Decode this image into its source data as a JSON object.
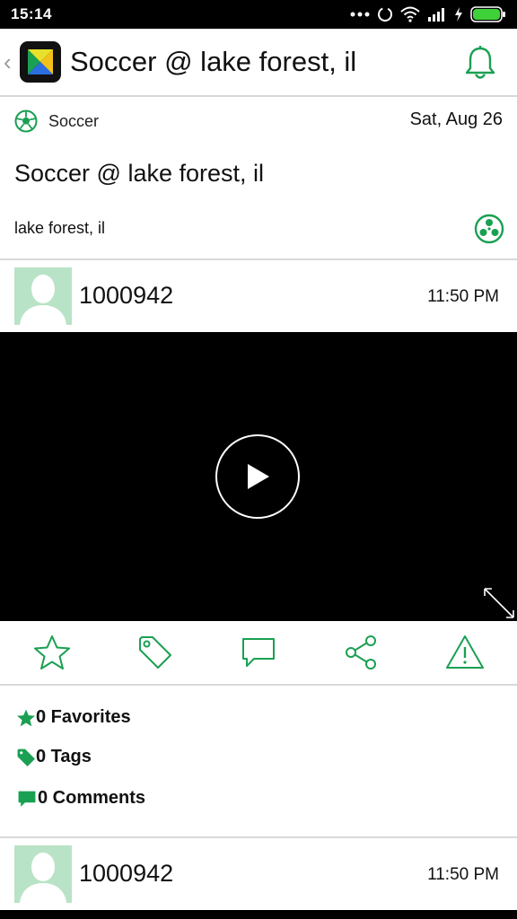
{
  "status_bar": {
    "time": "15:14"
  },
  "app_bar": {
    "title": "Soccer @ lake forest, il"
  },
  "event": {
    "sport": "Soccer",
    "date": "Sat, Aug 26",
    "title": "Soccer @ lake forest, il",
    "location": "lake forest, il"
  },
  "posts": [
    {
      "username": "1000942",
      "time": "11:50 PM"
    },
    {
      "username": "1000942",
      "time": "11:50 PM"
    }
  ],
  "actions": [
    {
      "icon": "star-icon"
    },
    {
      "icon": "tag-icon"
    },
    {
      "icon": "comment-icon"
    },
    {
      "icon": "share-icon"
    },
    {
      "icon": "warning-icon"
    }
  ],
  "stats": {
    "favorites": "0 Favorites",
    "tags": "0 Tags",
    "comments": "0 Comments"
  },
  "colors": {
    "accent": "#1aa052",
    "avatar_bg": "#b9e3c6",
    "video_bg": "#000000"
  }
}
